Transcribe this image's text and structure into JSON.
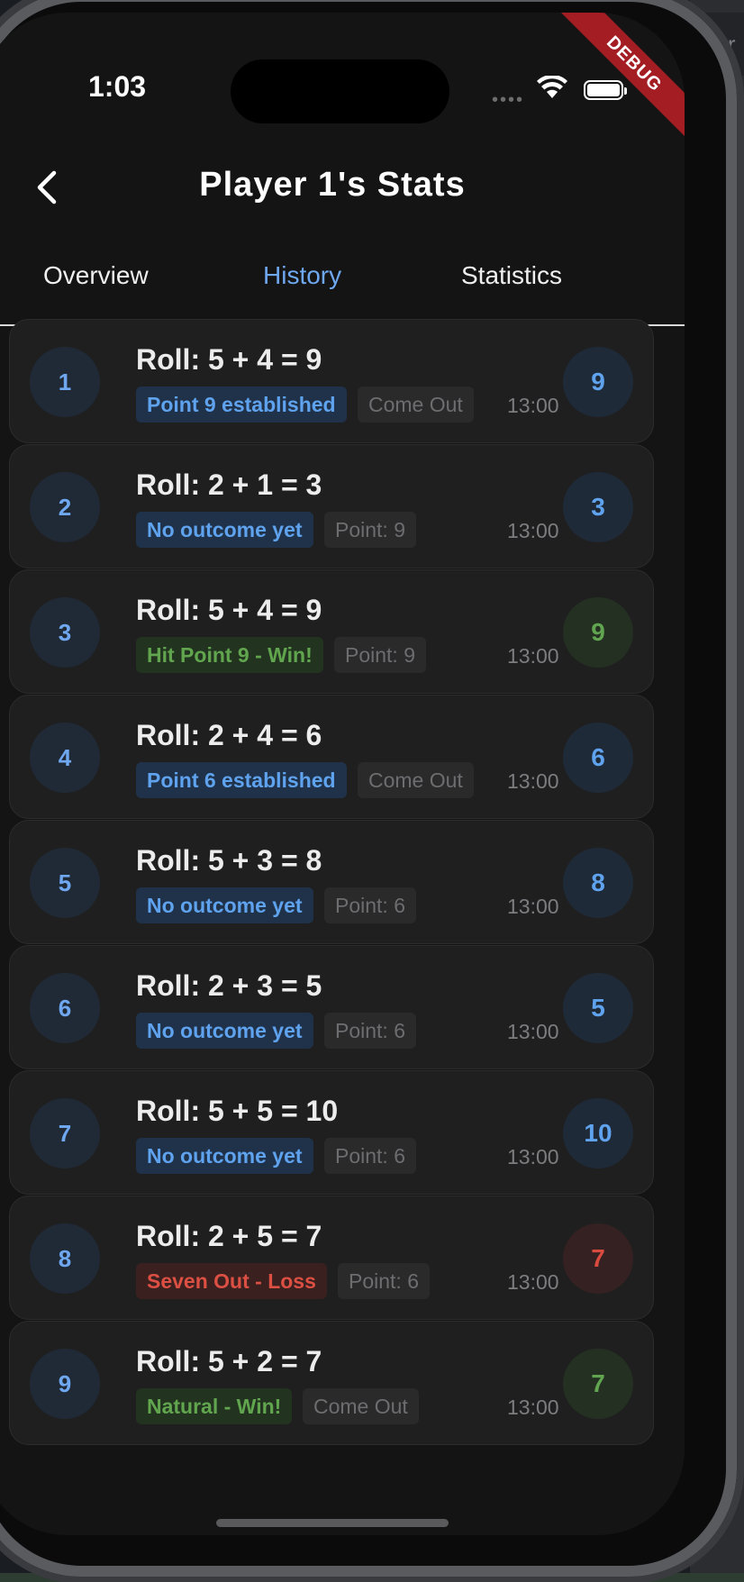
{
  "status_bar": {
    "time": "1:03",
    "signal": "••••",
    "debug_banner": "DEBUG"
  },
  "background": {
    "partial_text": "nver"
  },
  "header": {
    "back_icon": "chevron-left-icon",
    "title": "Player 1's Stats"
  },
  "tabs": [
    {
      "label": "Overview",
      "active": false
    },
    {
      "label": "History",
      "active": true
    },
    {
      "label": "Statistics",
      "active": false
    }
  ],
  "colors": {
    "accent_blue": "#5fa2ee",
    "win_green": "#61a64f",
    "loss_red": "#dc4f43",
    "card_bg": "#1f1f20"
  },
  "history": [
    {
      "index": "1",
      "roll": "Roll: 5 + 4 = 9",
      "outcome": "Point 9 established",
      "outcome_type": "blue",
      "phase": "Come Out",
      "time": "13:00",
      "total": "9",
      "total_type": "blue"
    },
    {
      "index": "2",
      "roll": "Roll: 2 + 1 = 3",
      "outcome": "No outcome yet",
      "outcome_type": "blue",
      "phase": "Point: 9",
      "time": "13:00",
      "total": "3",
      "total_type": "blue"
    },
    {
      "index": "3",
      "roll": "Roll: 5 + 4 = 9",
      "outcome": "Hit Point 9 - Win!",
      "outcome_type": "green",
      "phase": "Point: 9",
      "time": "13:00",
      "total": "9",
      "total_type": "green"
    },
    {
      "index": "4",
      "roll": "Roll: 2 + 4 = 6",
      "outcome": "Point 6 established",
      "outcome_type": "blue",
      "phase": "Come Out",
      "time": "13:00",
      "total": "6",
      "total_type": "blue"
    },
    {
      "index": "5",
      "roll": "Roll: 5 + 3 = 8",
      "outcome": "No outcome yet",
      "outcome_type": "blue",
      "phase": "Point: 6",
      "time": "13:00",
      "total": "8",
      "total_type": "blue"
    },
    {
      "index": "6",
      "roll": "Roll: 2 + 3 = 5",
      "outcome": "No outcome yet",
      "outcome_type": "blue",
      "phase": "Point: 6",
      "time": "13:00",
      "total": "5",
      "total_type": "blue"
    },
    {
      "index": "7",
      "roll": "Roll: 5 + 5 = 10",
      "outcome": "No outcome yet",
      "outcome_type": "blue",
      "phase": "Point: 6",
      "time": "13:00",
      "total": "10",
      "total_type": "blue"
    },
    {
      "index": "8",
      "roll": "Roll: 2 + 5 = 7",
      "outcome": "Seven Out - Loss",
      "outcome_type": "red",
      "phase": "Point: 6",
      "time": "13:00",
      "total": "7",
      "total_type": "red"
    },
    {
      "index": "9",
      "roll": "Roll: 5 + 2 = 7",
      "outcome": "Natural - Win!",
      "outcome_type": "green",
      "phase": "Come Out",
      "time": "13:00",
      "total": "7",
      "total_type": "green"
    }
  ]
}
